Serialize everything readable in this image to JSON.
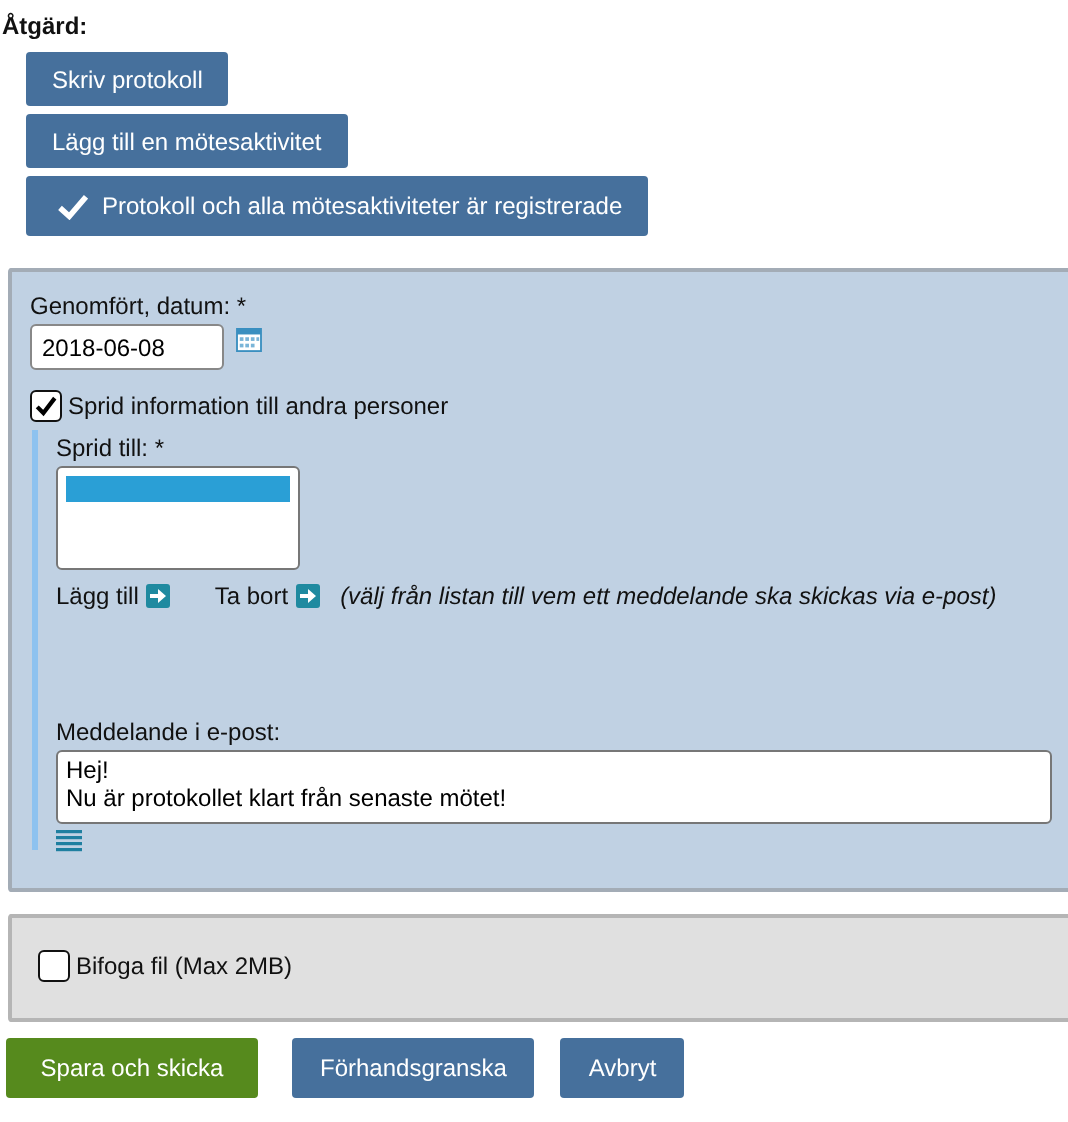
{
  "heading": "Åtgärd:",
  "actions": [
    {
      "label": "Skriv protokoll",
      "checked": false
    },
    {
      "label": "Lägg till en mötesaktivitet",
      "checked": false
    },
    {
      "label": "Protokoll och alla mötesaktiviteter är registrerade",
      "checked": true
    }
  ],
  "date": {
    "label": "Genomfört, datum: *",
    "value": "2018-06-08"
  },
  "spread": {
    "label": "Sprid information till andra personer",
    "checked": true
  },
  "recipients": {
    "label": "Sprid till: *",
    "items": [
      {
        "selected": true
      }
    ]
  },
  "add_link": "Lägg till",
  "remove_link": "Ta bort",
  "hint": "(välj från listan till vem ett meddelande ska skickas via e-post)",
  "message": {
    "label": "Meddelande i e-post:",
    "value": "Hej!\nNu är protokollet klart från senaste mötet!"
  },
  "attach": {
    "label": "Bifoga fil (Max 2MB)",
    "checked": false
  },
  "buttons": [
    {
      "label": "Spara och skicka",
      "kind": "primary"
    },
    {
      "label": "Förhandsgranska",
      "kind": "secondary"
    },
    {
      "label": "Avbryt",
      "kind": "secondary"
    }
  ]
}
